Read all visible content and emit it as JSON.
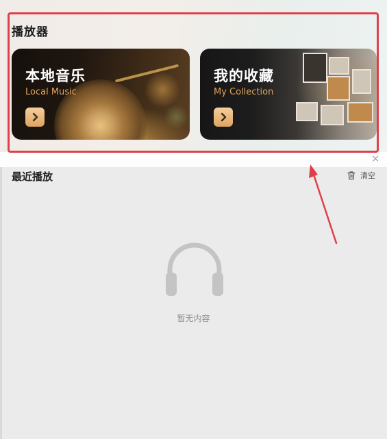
{
  "player": {
    "title": "播放器",
    "cards": [
      {
        "title": "本地音乐",
        "subtitle": "Local Music"
      },
      {
        "title": "我的收藏",
        "subtitle": "My Collection"
      }
    ]
  },
  "recent": {
    "title": "最近播放",
    "clear_label": "清空",
    "empty_text": "暂无内容"
  },
  "colors": {
    "annotation": "#e03f4a",
    "accent_subtitle": "#e2a45b",
    "arrow_button": "#dea462"
  }
}
